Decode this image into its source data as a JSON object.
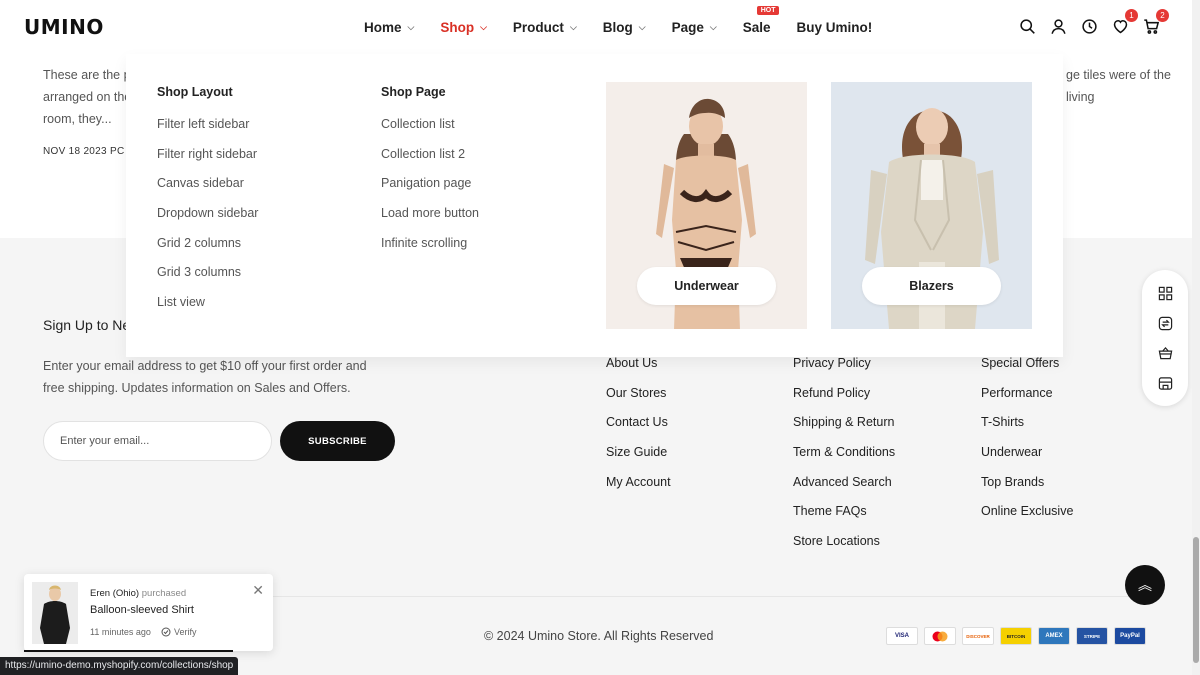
{
  "header": {
    "logo": "UMINO",
    "nav": [
      {
        "label": "Home",
        "chevron": true,
        "active": false
      },
      {
        "label": "Shop",
        "chevron": true,
        "active": true
      },
      {
        "label": "Product",
        "chevron": true,
        "active": false
      },
      {
        "label": "Blog",
        "chevron": true,
        "active": false
      },
      {
        "label": "Page",
        "chevron": true,
        "active": false
      },
      {
        "label": "Sale",
        "chevron": false,
        "active": false,
        "badge": "HOT"
      },
      {
        "label": "Buy Umino!",
        "chevron": false,
        "active": false
      }
    ],
    "icons": [
      "search-icon",
      "user-icon",
      "clock-icon",
      "heart-icon",
      "cart-icon"
    ],
    "wishlist_count": "1",
    "cart_count": "2",
    "accent_color": "#d93025"
  },
  "blog": {
    "excerpt_left": "These are the p arranged on the room, they...",
    "excerpt_right": "ge tiles were of the living",
    "meta": "NOV 18 2023   PC"
  },
  "mega_menu": {
    "shop_layout": {
      "title": "Shop Layout",
      "links": [
        "Filter left sidebar",
        "Filter right sidebar",
        "Canvas sidebar",
        "Dropdown sidebar",
        "Grid 2 columns",
        "Grid 3 columns",
        "List view"
      ]
    },
    "shop_page": {
      "title": "Shop Page",
      "links": [
        "Collection list",
        "Collection list 2",
        "Panigation page",
        "Load more button",
        "Infinite scrolling"
      ]
    },
    "promos": [
      {
        "label": "Underwear"
      },
      {
        "label": "Blazers"
      }
    ]
  },
  "newsletter": {
    "title": "Sign Up to Ne",
    "description": "Enter your email address to get $10 off your first order and free shipping. Updates information on Sales and Offers.",
    "email_placeholder": "Enter your email...",
    "subscribe_label": "SUBSCRIBE"
  },
  "footer_links": {
    "col1": [
      "About Us",
      "Our Stores",
      "Contact Us",
      "Size Guide",
      "My Account"
    ],
    "col2": [
      "Privacy Policy",
      "Refund Policy",
      "Shipping & Return",
      "Term & Conditions",
      "Advanced Search",
      "Theme FAQs",
      "Store Locations"
    ],
    "col3": [
      "Special Offers",
      "Performance",
      "T-Shirts",
      "Underwear",
      "Top Brands",
      "Online Exclusive"
    ]
  },
  "copyright": "© 2024 Umino Store. All Rights Reserved",
  "payments": [
    "VISA",
    "MC",
    "DISCOVER",
    "BITCOIN",
    "AMEX",
    "STRIPE",
    "PayPal"
  ],
  "side_toolbar": [
    "grid-icon",
    "compare-icon",
    "basket-icon",
    "store-icon"
  ],
  "toast": {
    "who": "Eren (Ohio)",
    "action": "purchased",
    "product": "Balloon-sleeved Shirt",
    "time": "11 minutes ago",
    "verify": "Verify"
  },
  "status_url": "https://umino-demo.myshopify.com/collections/shop"
}
